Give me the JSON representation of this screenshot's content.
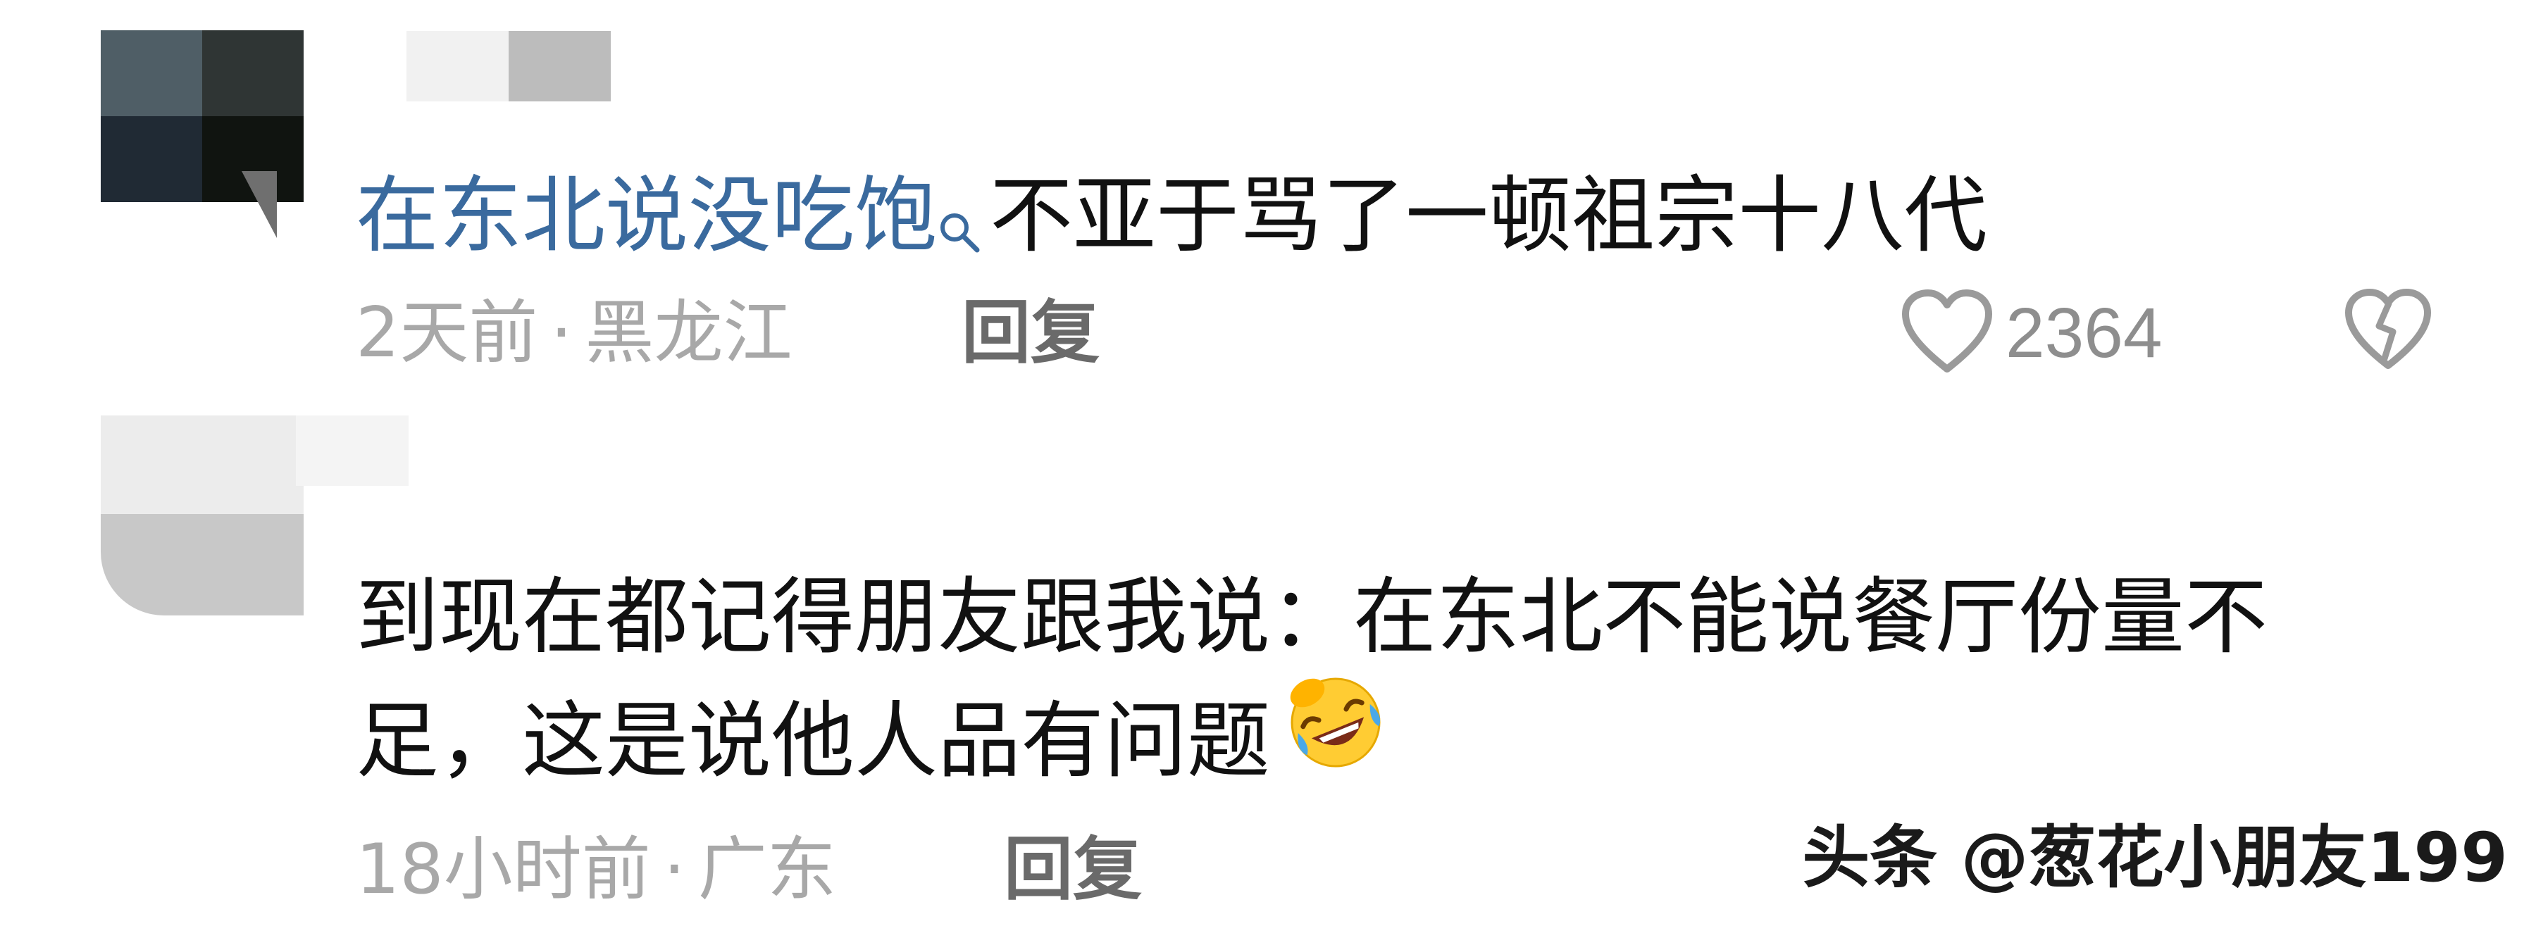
{
  "comments": [
    {
      "link_text": "在东北说没吃饱",
      "text": "不亚于骂了一顿祖宗十八代",
      "time": "2天前",
      "separator": "·",
      "location": "黑龙江",
      "reply_label": "回复",
      "like_count": "2364"
    },
    {
      "text_line1": "到现在都记得朋友跟我说：在东北不能说餐厅份量不",
      "text_line2": "足，这是说他人品有问题",
      "emoji": "rolling-on-floor-laughing",
      "time": "18小时前",
      "separator": "·",
      "location": "广东",
      "reply_label": "回复"
    }
  ],
  "watermark": "头条 @葱花小朋友199",
  "colors": {
    "link": "#3a6a9e",
    "meta": "#a8a8a8",
    "reply": "#6a6a6a",
    "icon": "#9a9a9a"
  }
}
